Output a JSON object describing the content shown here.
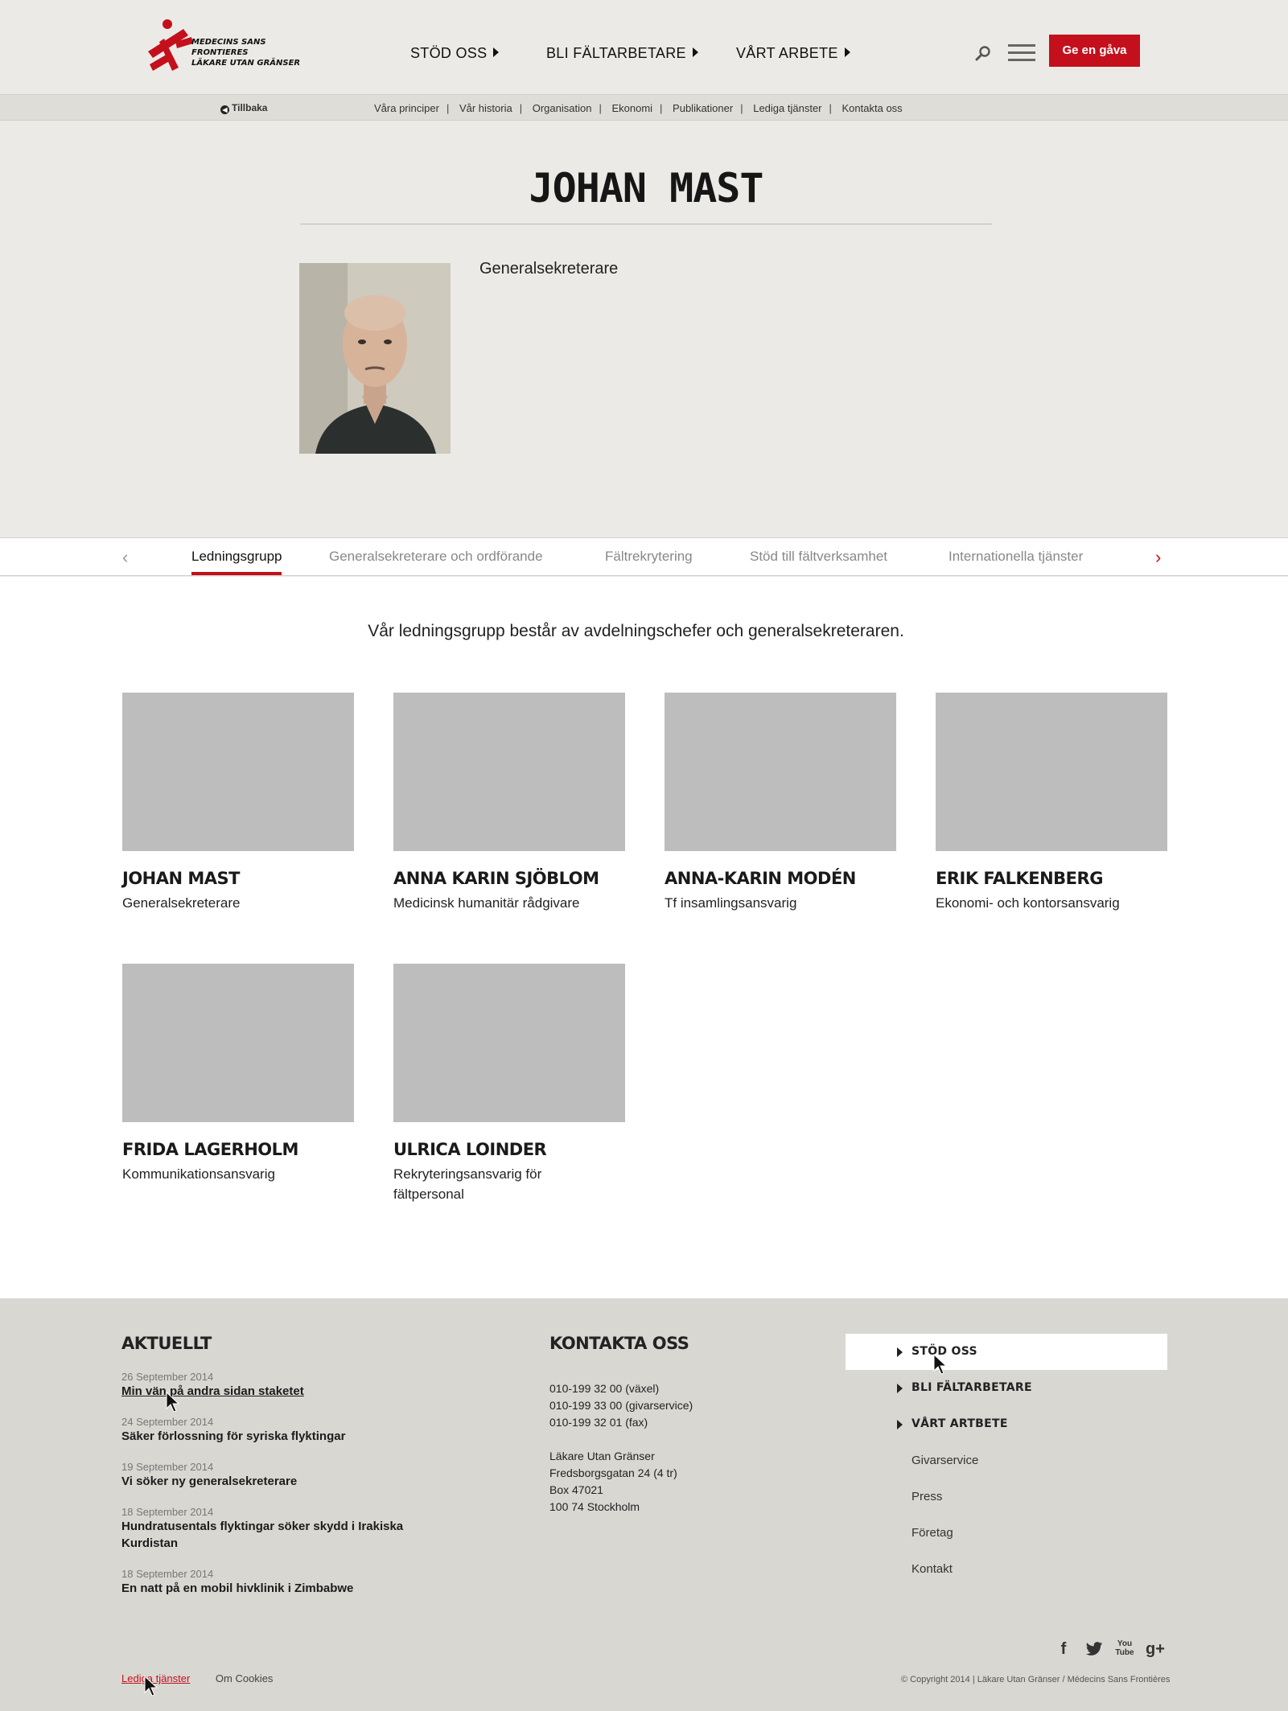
{
  "header": {
    "logo_line1": "MEDECINS SANS FRONTIERES",
    "logo_line2": "LÄKARE UTAN GRÄNSER",
    "nav": [
      {
        "label": "STÖD OSS"
      },
      {
        "label": "BLI FÄLTARBETARE"
      },
      {
        "label": "VÅRT ARBETE"
      }
    ],
    "give_label": "Ge en gåva",
    "icons": {
      "search": "search-icon",
      "menu": "hamburger-menu-icon"
    },
    "accent_color": "#c3101c"
  },
  "subnav": {
    "back_label": "Tillbaka",
    "links": [
      "Våra principer",
      "Vår historia",
      "Organisation",
      "Ekonomi",
      "Publikationer",
      "Lediga tjänster",
      "Kontakta oss"
    ],
    "separator": "|"
  },
  "profile": {
    "name": "JOHAN MAST",
    "title": "Generalsekreterare"
  },
  "tabs": {
    "items": [
      "Ledningsgrupp",
      "Generalsekreterare och ordförande",
      "Fältrekrytering",
      "Stöd till fältverksamhet",
      "Internationella tjänster"
    ],
    "active": "Ledningsgrupp"
  },
  "team": {
    "intro": "Vår ledningsgrupp består av avdelningschefer och generalsekreteraren.",
    "members": [
      {
        "name": "Johan Mast",
        "role": "Generalsekreterare"
      },
      {
        "name": "Anna Karin Sjöblom",
        "role": "Medicinsk humanitär rådgivare"
      },
      {
        "name": "Anna-Karin Modén",
        "role": "Tf insamlingsansvarig"
      },
      {
        "name": "Erik Falkenberg",
        "role": "Ekonomi- och kontorsansvarig"
      },
      {
        "name": "Frida Lagerholm",
        "role": "Kommunikationsansvarig"
      },
      {
        "name": "Ulrica Loinder",
        "role": "Rekryteringsansvarig för fältpersonal"
      }
    ]
  },
  "footer": {
    "news_heading": "AKTUELLT",
    "news": [
      {
        "date": "26 September 2014",
        "title": "Min vän på andra sidan staketet"
      },
      {
        "date": "24 September 2014",
        "title": "Säker förlossning för syriska flyktingar"
      },
      {
        "date": "19 September 2014",
        "title": "Vi söker ny generalsekreterare"
      },
      {
        "date": "18 September 2014",
        "title": "Hundratusentals flyktingar söker skydd i Irakiska Kurdistan"
      },
      {
        "date": "18 September 2014",
        "title": "En natt på en mobil hivklinik i Zimbabwe"
      }
    ],
    "contact_heading": "KONTAKTA OSS",
    "phones": [
      "010-199 32 00 (växel)",
      "010-199 33 00 (givarservice)",
      "010-199 32 01 (fax)"
    ],
    "address": [
      "Läkare Utan Gränser",
      "Fredsborgsgatan 24 (4 tr)",
      "Box 47021",
      "100 74 Stockholm"
    ],
    "menu": [
      {
        "label": "STÖD OSS"
      },
      {
        "label": "BLI FÄLTARBETARE"
      },
      {
        "label": "VÅRT ARTBETE"
      },
      {
        "label": "Givarservice"
      },
      {
        "label": "Press"
      },
      {
        "label": "Företag"
      },
      {
        "label": "Kontakt"
      }
    ],
    "social": {
      "facebook": "f",
      "youtube_1": "You",
      "youtube_2": "Tube",
      "googleplus": "g+"
    },
    "bottom_links": [
      "Lediga tjänster",
      "Om Cookies"
    ],
    "copyright": "© Copyright 2014 | Läkare Utan Gränser / Médecins Sans Frontières"
  }
}
